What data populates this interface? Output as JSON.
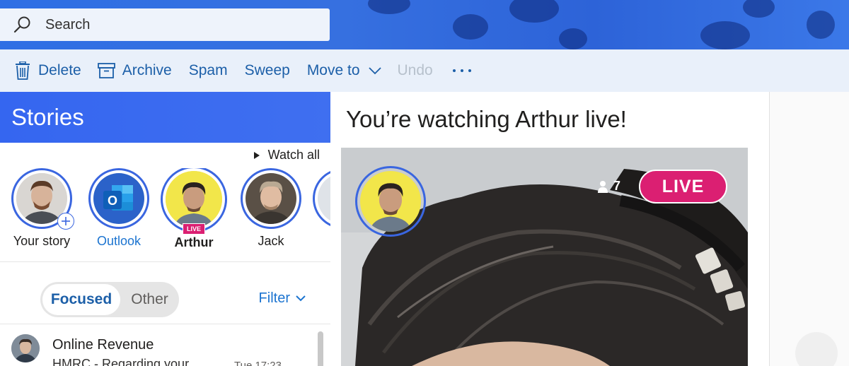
{
  "search": {
    "placeholder": "Search"
  },
  "toolbar": {
    "delete_label": "Delete",
    "archive_label": "Archive",
    "spam_label": "Spam",
    "sweep_label": "Sweep",
    "move_to_label": "Move to",
    "undo_label": "Undo"
  },
  "stories": {
    "title": "Stories",
    "watch_all": "Watch all",
    "items": [
      {
        "label": "Your story",
        "icon": "add-icon"
      },
      {
        "label": "Outlook",
        "icon": "outlook-icon"
      },
      {
        "label": "Arthur",
        "badge": "LIVE"
      },
      {
        "label": "Jack"
      }
    ]
  },
  "mail_tabs": {
    "focused": "Focused",
    "other": "Other",
    "filter": "Filter"
  },
  "mail_list": [
    {
      "sender": "Online Revenue",
      "subject": "HMRC - Regarding your",
      "time": "Tue 17:23"
    }
  ],
  "reading": {
    "title": "You’re watching Arthur live!",
    "viewer_count": "7",
    "live_label": "LIVE"
  },
  "colors": {
    "accent": "#1c5fa8",
    "live": "#db1f72",
    "stories_header": "#3566f0",
    "story_ring": "#3a66e0"
  }
}
